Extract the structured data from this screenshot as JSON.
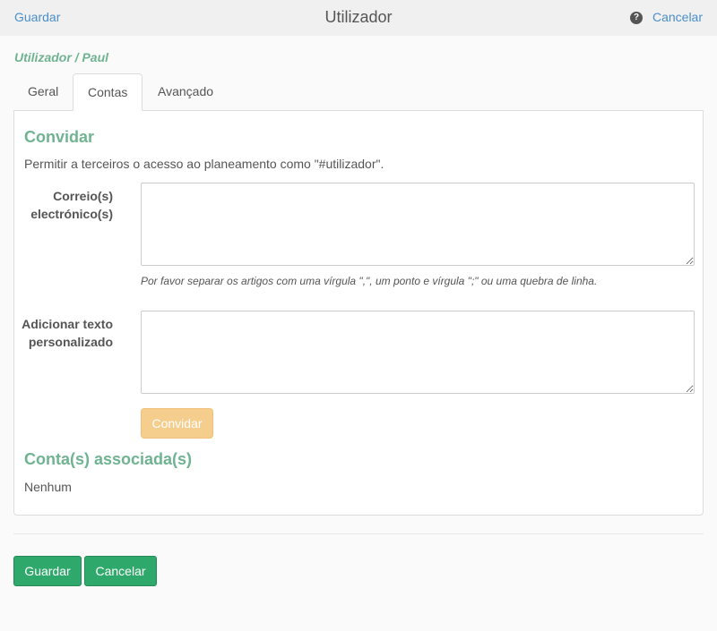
{
  "header": {
    "save_label": "Guardar",
    "title": "Utilizador",
    "help_icon_glyph": "?",
    "cancel_label": "Cancelar"
  },
  "breadcrumb": "Utilizador / Paul",
  "tabs": [
    {
      "label": "Geral",
      "active": false
    },
    {
      "label": "Contas",
      "active": true
    },
    {
      "label": "Avançado",
      "active": false
    }
  ],
  "invite": {
    "title": "Convidar",
    "intro": "Permitir a terceiros o acesso ao planeamento como \"#utilizador\".",
    "emails_label": "Correio(s) electrónico(s)",
    "emails_value": "",
    "emails_help": "Por favor separar os artigos com uma vírgula \",\", um ponto e vírgula \";\" ou uma quebra de linha.",
    "custom_text_label": "Adicionar texto personalizado",
    "custom_text_value": "",
    "invite_button": "Convidar"
  },
  "associated": {
    "title": "Conta(s) associada(s)",
    "empty_text": "Nenhum"
  },
  "footer": {
    "save_label": "Guardar",
    "cancel_label": "Cancelar"
  },
  "colors": {
    "accent_green": "#6fb391",
    "link_blue": "#4a8ec8",
    "primary_green": "#2fa96b",
    "invite_orange": "#f5cd8d"
  }
}
